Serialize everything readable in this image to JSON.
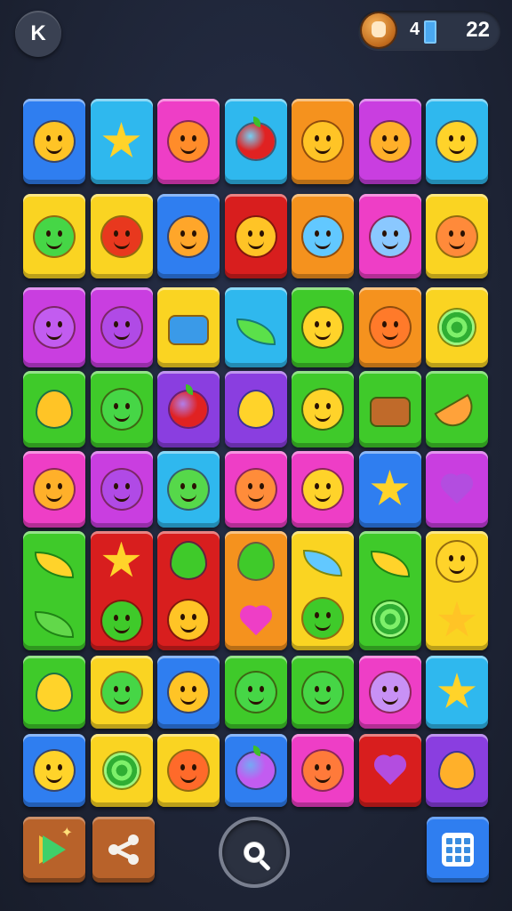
{
  "header": {
    "back_label": "K",
    "moves": "4",
    "score": "22"
  },
  "colors": {
    "blue": "#2f7ef0",
    "cyan": "#2fb8ee",
    "pink": "#ee3ec6",
    "magenta": "#c93ee0",
    "orange": "#f5921e",
    "yellow": "#fad422",
    "green": "#3fca2a",
    "red": "#d81e1e",
    "purple": "#8a3ee0"
  },
  "board": {
    "rows": [
      [
        {
          "bg": "blue",
          "icons": [
            {
              "kind": "face",
              "color": "#ffc426"
            }
          ]
        },
        {
          "bg": "cyan",
          "icons": [
            {
              "kind": "star",
              "color": "#ffd32a"
            }
          ]
        },
        {
          "bg": "pink",
          "icons": [
            {
              "kind": "face",
              "color": "#ff8c2a"
            }
          ]
        },
        {
          "bg": "cyan",
          "icons": [
            {
              "kind": "apple",
              "color": "#e02222"
            }
          ]
        },
        {
          "bg": "orange",
          "icons": [
            {
              "kind": "face",
              "color": "#ffc426"
            }
          ]
        },
        {
          "bg": "magenta",
          "icons": [
            {
              "kind": "face",
              "color": "#ffb02a"
            }
          ]
        },
        {
          "bg": "cyan",
          "icons": [
            {
              "kind": "face",
              "color": "#ffd32a"
            }
          ]
        }
      ],
      [
        {
          "bg": "yellow",
          "icons": [
            {
              "kind": "face",
              "color": "#46d646"
            }
          ]
        },
        {
          "bg": "yellow",
          "icons": [
            {
              "kind": "face",
              "color": "#e8381e"
            }
          ]
        },
        {
          "bg": "blue",
          "icons": [
            {
              "kind": "face",
              "color": "#ffa62a"
            }
          ]
        },
        {
          "bg": "red",
          "icons": [
            {
              "kind": "face",
              "color": "#ffc426"
            }
          ]
        },
        {
          "bg": "orange",
          "icons": [
            {
              "kind": "face",
              "color": "#62c8ff"
            }
          ]
        },
        {
          "bg": "pink",
          "icons": [
            {
              "kind": "face",
              "color": "#8ac8ff"
            }
          ]
        },
        {
          "bg": "yellow",
          "icons": [
            {
              "kind": "face",
              "color": "#ff8a3a"
            }
          ]
        }
      ],
      [
        {
          "bg": "magenta",
          "icons": [
            {
              "kind": "face",
              "color": "#c25cf0"
            }
          ]
        },
        {
          "bg": "magenta",
          "icons": [
            {
              "kind": "face",
              "color": "#b04ae6"
            }
          ]
        },
        {
          "bg": "yellow",
          "icons": [
            {
              "kind": "box",
              "color": "#3a9ae8"
            }
          ]
        },
        {
          "bg": "cyan",
          "icons": [
            {
              "kind": "leaf",
              "color": "#5be04a"
            }
          ]
        },
        {
          "bg": "green",
          "icons": [
            {
              "kind": "face",
              "color": "#ffd32a"
            }
          ]
        },
        {
          "bg": "orange",
          "icons": [
            {
              "kind": "face",
              "color": "#ff7a2a"
            }
          ]
        },
        {
          "bg": "yellow",
          "icons": [
            {
              "kind": "swirl",
              "color": "#3fc23a"
            }
          ]
        }
      ],
      [
        {
          "bg": "green",
          "icons": [
            {
              "kind": "drop",
              "color": "#ffc426"
            }
          ]
        },
        {
          "bg": "green",
          "icons": [
            {
              "kind": "face",
              "color": "#46d646"
            }
          ]
        },
        {
          "bg": "purple",
          "icons": [
            {
              "kind": "apple",
              "color": "#e02222"
            }
          ]
        },
        {
          "bg": "purple",
          "icons": [
            {
              "kind": "drop",
              "color": "#ffd32a"
            }
          ]
        },
        {
          "bg": "green",
          "icons": [
            {
              "kind": "face",
              "color": "#ffd32a"
            }
          ]
        },
        {
          "bg": "green",
          "icons": [
            {
              "kind": "box",
              "color": "#c06a2a"
            }
          ]
        },
        {
          "bg": "green",
          "icons": [
            {
              "kind": "slice",
              "color": "#ffa23a"
            }
          ]
        }
      ],
      [
        {
          "bg": "pink",
          "icons": [
            {
              "kind": "face",
              "color": "#ffb02a"
            }
          ]
        },
        {
          "bg": "magenta",
          "icons": [
            {
              "kind": "face",
              "color": "#b04ae6"
            }
          ]
        },
        {
          "bg": "cyan",
          "icons": [
            {
              "kind": "face",
              "color": "#56d84a"
            }
          ]
        },
        {
          "bg": "pink",
          "icons": [
            {
              "kind": "face",
              "color": "#ff8c3a"
            }
          ]
        },
        {
          "bg": "pink",
          "icons": [
            {
              "kind": "face",
              "color": "#ffd32a"
            }
          ]
        },
        {
          "bg": "blue",
          "icons": [
            {
              "kind": "star",
              "color": "#ffd32a"
            }
          ]
        },
        {
          "bg": "magenta",
          "icons": [
            {
              "kind": "heart",
              "color": "#b34de0"
            }
          ]
        }
      ],
      [
        {
          "bg": "green",
          "icons": [
            {
              "kind": "leaf",
              "color": "#ffd32a"
            },
            {
              "kind": "leaf",
              "color": "#62d84a"
            }
          ]
        },
        {
          "bg": "red",
          "icons": [
            {
              "kind": "star",
              "color": "#ffd32a"
            },
            {
              "kind": "face",
              "color": "#3fca2a"
            }
          ]
        },
        {
          "bg": "red",
          "icons": [
            {
              "kind": "drop",
              "color": "#3fca2a"
            },
            {
              "kind": "face",
              "color": "#ffc426"
            }
          ]
        },
        {
          "bg": "orange",
          "icons": [
            {
              "kind": "drop",
              "color": "#3fca2a"
            },
            {
              "kind": "heart",
              "color": "#ee3ec6"
            }
          ]
        },
        {
          "bg": "yellow",
          "icons": [
            {
              "kind": "leaf",
              "color": "#62c8ff"
            },
            {
              "kind": "face",
              "color": "#3fca2a"
            }
          ]
        },
        {
          "bg": "green",
          "icons": [
            {
              "kind": "leaf",
              "color": "#ffd32a"
            },
            {
              "kind": "swirl",
              "color": "#3fca2a"
            }
          ]
        },
        {
          "bg": "yellow",
          "icons": [
            {
              "kind": "face",
              "color": "#ffd32a"
            },
            {
              "kind": "star",
              "color": "#ffc426"
            }
          ]
        }
      ],
      [
        {
          "bg": "green",
          "icons": [
            {
              "kind": "drop",
              "color": "#ffd32a"
            }
          ]
        },
        {
          "bg": "yellow",
          "icons": [
            {
              "kind": "face",
              "color": "#46d646"
            }
          ]
        },
        {
          "bg": "blue",
          "icons": [
            {
              "kind": "face",
              "color": "#ffc426"
            }
          ]
        },
        {
          "bg": "green",
          "icons": [
            {
              "kind": "face",
              "color": "#46d646"
            }
          ]
        },
        {
          "bg": "green",
          "icons": [
            {
              "kind": "face",
              "color": "#46d646"
            }
          ]
        },
        {
          "bg": "pink",
          "icons": [
            {
              "kind": "face",
              "color": "#c891f5"
            }
          ]
        },
        {
          "bg": "cyan",
          "icons": [
            {
              "kind": "star",
              "color": "#ffd32a"
            }
          ]
        }
      ],
      [
        {
          "bg": "blue",
          "icons": [
            {
              "kind": "face",
              "color": "#ffd32a"
            }
          ]
        },
        {
          "bg": "yellow",
          "icons": [
            {
              "kind": "swirl",
              "color": "#3fc23a"
            }
          ]
        },
        {
          "bg": "yellow",
          "icons": [
            {
              "kind": "face",
              "color": "#ff6a2a"
            }
          ]
        },
        {
          "bg": "blue",
          "icons": [
            {
              "kind": "apple",
              "color": "#c25cf0"
            }
          ]
        },
        {
          "bg": "pink",
          "icons": [
            {
              "kind": "face",
              "color": "#ff7a3a"
            }
          ]
        },
        {
          "bg": "red",
          "icons": [
            {
              "kind": "heart",
              "color": "#b34de0"
            }
          ]
        },
        {
          "bg": "purple",
          "icons": [
            {
              "kind": "drop",
              "color": "#ffb02a"
            }
          ]
        }
      ]
    ]
  },
  "toolbar": {
    "play_icon": "play-store-icon",
    "share_icon": "share-icon",
    "search_icon": "search-icon",
    "grid_icon": "calendar-grid-icon",
    "play_bg": "#b8622a",
    "share_bg": "#b8622a",
    "grid_bg": "#2f7ef0"
  }
}
